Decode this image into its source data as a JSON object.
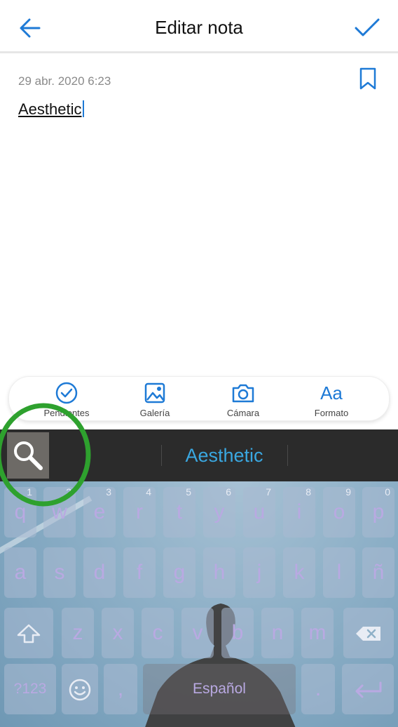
{
  "header": {
    "title": "Editar nota",
    "back_icon": "arrow-left-icon",
    "confirm_icon": "checkmark-icon",
    "accent_color": "#1e7ad6"
  },
  "note": {
    "timestamp": "29 abr. 2020 6:23",
    "bookmark_icon": "bookmark-icon",
    "body": "Aesthetic"
  },
  "toolbar": {
    "items": [
      {
        "label": "Pendientes",
        "icon": "check-circle-icon"
      },
      {
        "label": "Galería",
        "icon": "image-icon"
      },
      {
        "label": "Cámara",
        "icon": "camera-icon"
      },
      {
        "label": "Formato",
        "icon": "text-format-icon",
        "glyph": "Aa"
      }
    ]
  },
  "suggestion_bar": {
    "search_icon": "magnifier-icon",
    "suggestion": "Aesthetic",
    "accent_color": "#3aa7e0"
  },
  "keyboard": {
    "row1": [
      {
        "key": "q",
        "num": "1"
      },
      {
        "key": "w",
        "num": "2"
      },
      {
        "key": "e",
        "num": "3"
      },
      {
        "key": "r",
        "num": "4"
      },
      {
        "key": "t",
        "num": "5"
      },
      {
        "key": "y",
        "num": "6"
      },
      {
        "key": "u",
        "num": "7"
      },
      {
        "key": "i",
        "num": "8"
      },
      {
        "key": "o",
        "num": "9"
      },
      {
        "key": "p",
        "num": "0"
      }
    ],
    "row2": [
      "a",
      "s",
      "d",
      "f",
      "g",
      "h",
      "j",
      "k",
      "l",
      "ñ"
    ],
    "row3": [
      "z",
      "x",
      "c",
      "v",
      "b",
      "n",
      "m"
    ],
    "symbols_label": "?123",
    "comma": ",",
    "space_label": "Español",
    "period": ".",
    "shift_icon": "shift-arrow-icon",
    "backspace_icon": "backspace-icon",
    "emoji_icon": "emoji-icon",
    "enter_icon": "enter-arrow-icon",
    "key_text_color": "#b9a9e2"
  }
}
